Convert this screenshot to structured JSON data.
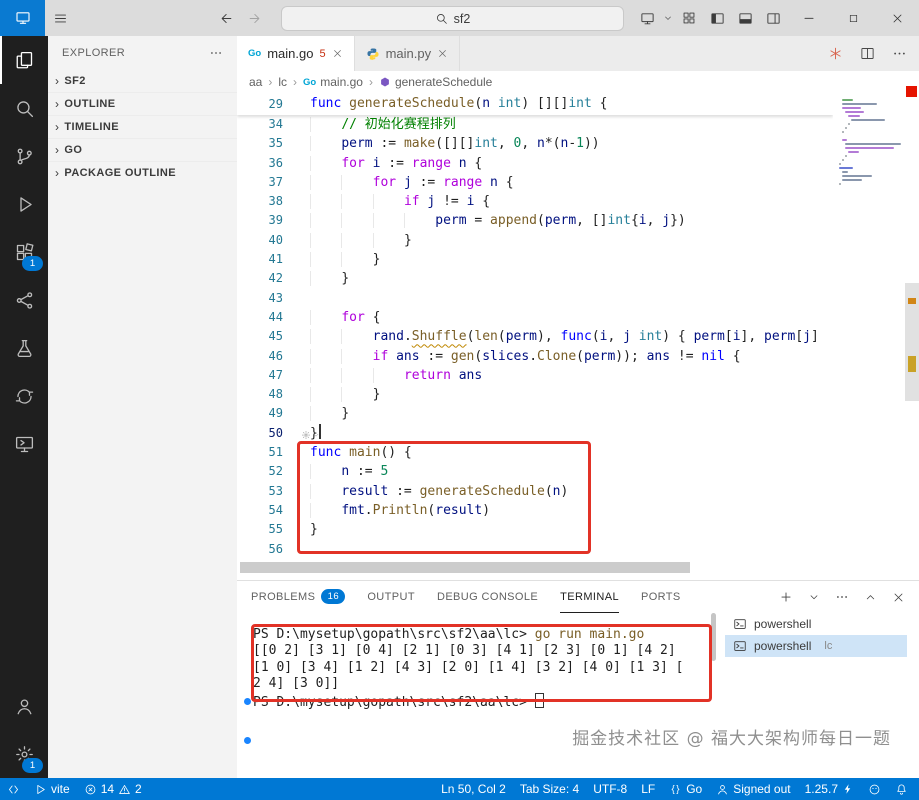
{
  "colors": {
    "status_bar": "#0078d4",
    "annotation_red": "#e23226",
    "activity_badge_blue": "#0078d4",
    "tab_error_badge": "#c72e0f"
  },
  "titlebar": {
    "search_value": "sf2"
  },
  "activity_bar": {
    "items": [
      {
        "name": "explorer",
        "icon": "files",
        "active": true
      },
      {
        "name": "search",
        "icon": "search"
      },
      {
        "name": "source-control",
        "icon": "scm"
      },
      {
        "name": "run-debug",
        "icon": "run"
      },
      {
        "name": "extensions",
        "icon": "extensions",
        "badge": "1"
      },
      {
        "name": "live-share",
        "icon": "share"
      },
      {
        "name": "testing",
        "icon": "flask"
      },
      {
        "name": "sync",
        "icon": "sync"
      },
      {
        "name": "remote-explorer",
        "icon": "remote-monitor"
      }
    ],
    "bottom": [
      {
        "name": "accounts",
        "icon": "person"
      },
      {
        "name": "settings",
        "icon": "gear",
        "badge": "1"
      }
    ]
  },
  "sidebar": {
    "title": "EXPLORER",
    "sections": [
      {
        "label": "SF2"
      },
      {
        "label": "OUTLINE"
      },
      {
        "label": "TIMELINE"
      },
      {
        "label": "GO"
      },
      {
        "label": "PACKAGE OUTLINE"
      }
    ]
  },
  "editor": {
    "tabs": [
      {
        "label": "main.go",
        "icon": "go",
        "badge": "5",
        "active": true
      },
      {
        "label": "main.py",
        "icon": "python",
        "active": false
      }
    ],
    "breadcrumbs": [
      {
        "label": "aa"
      },
      {
        "label": "lc"
      },
      {
        "label": "main.go",
        "icon": "go"
      },
      {
        "label": "generateSchedule",
        "icon": "method"
      }
    ],
    "sticky": {
      "num": "29",
      "i": 0,
      "t": [
        [
          "kw",
          "func"
        ],
        [
          "p",
          " "
        ],
        [
          "fn",
          "generateSchedule"
        ],
        [
          "p",
          "("
        ],
        [
          "v",
          "n"
        ],
        [
          "p",
          " "
        ],
        [
          "ty",
          "int"
        ],
        [
          "p",
          ") [][]"
        ],
        [
          "ty",
          "int"
        ],
        [
          "p",
          " {"
        ]
      ]
    },
    "lines": [
      {
        "n": 34,
        "i": 1,
        "t": [
          [
            "cm",
            "// 初始化赛程排列"
          ]
        ]
      },
      {
        "n": 35,
        "i": 1,
        "t": [
          [
            "v",
            "perm"
          ],
          [
            "p",
            " := "
          ],
          [
            "fn",
            "make"
          ],
          [
            "p",
            "([][]"
          ],
          [
            "ty",
            "int"
          ],
          [
            "p",
            ", "
          ],
          [
            "nu",
            "0"
          ],
          [
            "p",
            ", "
          ],
          [
            "v",
            "n"
          ],
          [
            "p",
            "*("
          ],
          [
            "v",
            "n"
          ],
          [
            "p",
            "-"
          ],
          [
            "nu",
            "1"
          ],
          [
            "p",
            "))"
          ]
        ]
      },
      {
        "n": 36,
        "i": 1,
        "t": [
          [
            "kc",
            "for"
          ],
          [
            "p",
            " "
          ],
          [
            "v",
            "i"
          ],
          [
            "p",
            " := "
          ],
          [
            "kc",
            "range"
          ],
          [
            "p",
            " "
          ],
          [
            "v",
            "n"
          ],
          [
            "p",
            " {"
          ]
        ]
      },
      {
        "n": 37,
        "i": 2,
        "t": [
          [
            "kc",
            "for"
          ],
          [
            "p",
            " "
          ],
          [
            "v",
            "j"
          ],
          [
            "p",
            " := "
          ],
          [
            "kc",
            "range"
          ],
          [
            "p",
            " "
          ],
          [
            "v",
            "n"
          ],
          [
            "p",
            " {"
          ]
        ]
      },
      {
        "n": 38,
        "i": 3,
        "t": [
          [
            "kc",
            "if"
          ],
          [
            "p",
            " "
          ],
          [
            "v",
            "j"
          ],
          [
            "p",
            " != "
          ],
          [
            "v",
            "i"
          ],
          [
            "p",
            " {"
          ]
        ]
      },
      {
        "n": 39,
        "i": 4,
        "t": [
          [
            "v",
            "perm"
          ],
          [
            "p",
            " = "
          ],
          [
            "fn",
            "append"
          ],
          [
            "p",
            "("
          ],
          [
            "v",
            "perm"
          ],
          [
            "p",
            ", []"
          ],
          [
            "ty",
            "int"
          ],
          [
            "p",
            "{"
          ],
          [
            "v",
            "i"
          ],
          [
            "p",
            ", "
          ],
          [
            "v",
            "j"
          ],
          [
            "p",
            "})"
          ]
        ]
      },
      {
        "n": 40,
        "i": 3,
        "t": [
          [
            "p",
            "}"
          ]
        ]
      },
      {
        "n": 41,
        "i": 2,
        "t": [
          [
            "p",
            "}"
          ]
        ]
      },
      {
        "n": 42,
        "i": 1,
        "t": [
          [
            "p",
            "}"
          ]
        ]
      },
      {
        "n": 43,
        "i": 0,
        "t": []
      },
      {
        "n": 44,
        "i": 1,
        "t": [
          [
            "kc",
            "for"
          ],
          [
            "p",
            " {"
          ]
        ]
      },
      {
        "n": 45,
        "i": 2,
        "t": [
          [
            "v",
            "rand"
          ],
          [
            "p",
            "."
          ],
          [
            "fw",
            "Shuffle"
          ],
          [
            "p",
            "("
          ],
          [
            "fn",
            "len"
          ],
          [
            "p",
            "("
          ],
          [
            "v",
            "perm"
          ],
          [
            "p",
            "), "
          ],
          [
            "kw",
            "func"
          ],
          [
            "p",
            "("
          ],
          [
            "v",
            "i"
          ],
          [
            "p",
            ", "
          ],
          [
            "v",
            "j"
          ],
          [
            "p",
            " "
          ],
          [
            "ty",
            "int"
          ],
          [
            "p",
            ") { "
          ],
          [
            "v",
            "perm"
          ],
          [
            "p",
            "["
          ],
          [
            "v",
            "i"
          ],
          [
            "p",
            "], "
          ],
          [
            "v",
            "perm"
          ],
          [
            "p",
            "["
          ],
          [
            "v",
            "j"
          ],
          [
            "p",
            "]"
          ]
        ]
      },
      {
        "n": 46,
        "i": 2,
        "t": [
          [
            "kc",
            "if"
          ],
          [
            "p",
            " "
          ],
          [
            "v",
            "ans"
          ],
          [
            "p",
            " := "
          ],
          [
            "fn",
            "gen"
          ],
          [
            "p",
            "("
          ],
          [
            "v",
            "slices"
          ],
          [
            "p",
            "."
          ],
          [
            "fn",
            "Clone"
          ],
          [
            "p",
            "("
          ],
          [
            "v",
            "perm"
          ],
          [
            "p",
            ")); "
          ],
          [
            "v",
            "ans"
          ],
          [
            "p",
            " != "
          ],
          [
            "kw",
            "nil"
          ],
          [
            "p",
            " {"
          ]
        ]
      },
      {
        "n": 47,
        "i": 3,
        "t": [
          [
            "kc",
            "return"
          ],
          [
            "p",
            " "
          ],
          [
            "v",
            "ans"
          ]
        ]
      },
      {
        "n": 48,
        "i": 2,
        "t": [
          [
            "p",
            "}"
          ]
        ]
      },
      {
        "n": 49,
        "i": 1,
        "t": [
          [
            "p",
            "}"
          ]
        ]
      },
      {
        "n": 50,
        "i": 0,
        "a": true,
        "t": [
          [
            "p",
            "}"
          ],
          [
            "cur",
            ""
          ]
        ]
      },
      {
        "n": 51,
        "i": 0,
        "t": [
          [
            "kw",
            "func"
          ],
          [
            "p",
            " "
          ],
          [
            "fn",
            "main"
          ],
          [
            "p",
            "() {"
          ]
        ]
      },
      {
        "n": 52,
        "i": 1,
        "t": [
          [
            "v",
            "n"
          ],
          [
            "p",
            " := "
          ],
          [
            "nu",
            "5"
          ]
        ]
      },
      {
        "n": 53,
        "i": 1,
        "t": [
          [
            "v",
            "result"
          ],
          [
            "p",
            " := "
          ],
          [
            "fn",
            "generateSchedule"
          ],
          [
            "p",
            "("
          ],
          [
            "v",
            "n"
          ],
          [
            "p",
            ")"
          ]
        ]
      },
      {
        "n": 54,
        "i": 1,
        "t": [
          [
            "v",
            "fmt"
          ],
          [
            "p",
            "."
          ],
          [
            "fn",
            "Println"
          ],
          [
            "p",
            "("
          ],
          [
            "v",
            "result"
          ],
          [
            "p",
            ")"
          ]
        ]
      },
      {
        "n": 55,
        "i": 0,
        "t": [
          [
            "p",
            "}"
          ]
        ]
      },
      {
        "n": 56,
        "i": 0,
        "t": []
      }
    ]
  },
  "panel": {
    "tabs": [
      {
        "label": "PROBLEMS",
        "badge": "16"
      },
      {
        "label": "OUTPUT"
      },
      {
        "label": "DEBUG CONSOLE"
      },
      {
        "label": "TERMINAL",
        "active": true
      },
      {
        "label": "PORTS"
      }
    ],
    "terminal": {
      "lines": [
        {
          "parts": [
            [
              "prompt",
              "PS D:\\mysetup\\gopath\\src\\sf2\\aa\\lc> "
            ],
            [
              "cmd",
              "go run main.go"
            ]
          ]
        },
        {
          "parts": [
            [
              "out",
              "[[0 2] [3 1] [0 4] [2 1] [0 3] [4 1] [2 3] [0 1] [4 2]"
            ]
          ]
        },
        {
          "parts": [
            [
              "out",
              "[1 0] [3 4] [1 2] [4 3] [2 0] [1 4] [3 2] [4 0] [1 3] ["
            ]
          ]
        },
        {
          "parts": [
            [
              "out",
              "2 4] [3 0]]"
            ]
          ]
        },
        {
          "parts": [
            [
              "prompt",
              "PS D:\\mysetup\\gopath\\src\\sf2\\aa\\lc> "
            ],
            [
              "cursor",
              ""
            ]
          ]
        }
      ],
      "tabs_list": [
        {
          "label": "powershell",
          "icon": "terminal"
        },
        {
          "label": "powershell",
          "suffix": "lc",
          "icon": "terminal",
          "active": true
        }
      ]
    }
  },
  "watermark": "掘金技术社区 @ 福大大架构师每日一题",
  "status_bar": {
    "left": [
      {
        "name": "remote",
        "icon": "remote"
      },
      {
        "name": "task-vite",
        "icon": "play",
        "label": "vite"
      },
      {
        "name": "problems",
        "parts": [
          {
            "icon": "error",
            "label": "14"
          },
          {
            "icon": "warning",
            "label": "2"
          }
        ]
      }
    ],
    "right": [
      {
        "name": "cursor-position",
        "label": "Ln 50, Col 2"
      },
      {
        "name": "indentation",
        "label": "Tab Size: 4"
      },
      {
        "name": "encoding",
        "label": "UTF-8"
      },
      {
        "name": "eol",
        "label": "LF"
      },
      {
        "name": "language-mode",
        "icon": "braces",
        "label": "Go"
      },
      {
        "name": "accounts-signed-out",
        "icon": "person",
        "label": "Signed out"
      },
      {
        "name": "go-version",
        "label": "1.25.7",
        "icon2": "bolt"
      },
      {
        "name": "go-gopher",
        "icon": "gopher"
      },
      {
        "name": "notifications",
        "icon": "bell"
      }
    ]
  }
}
